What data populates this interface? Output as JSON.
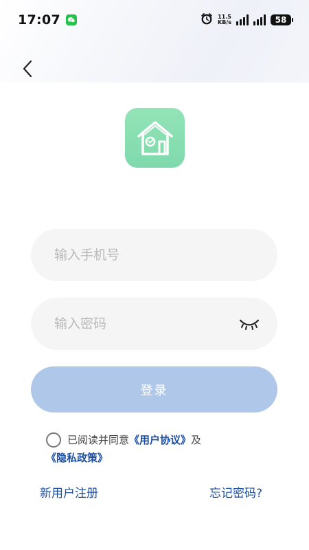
{
  "status_bar": {
    "time": "17:07",
    "net_speed_value": "11.5",
    "net_speed_unit": "KB/s",
    "battery": "58"
  },
  "login_form": {
    "phone_placeholder": "输入手机号",
    "password_placeholder": "输入密码",
    "login_label": "登录"
  },
  "agreement": {
    "prefix": "已阅读并同意",
    "user_agreement": "《用户协议》",
    "and": "及",
    "privacy_policy": "《隐私政策》"
  },
  "links": {
    "register": "新用户注册",
    "forgot_password": "忘记密码?"
  },
  "colors": {
    "accent": "#1b4fa3",
    "login_button": "#afc7e8",
    "app_icon": "#86ddb0"
  }
}
